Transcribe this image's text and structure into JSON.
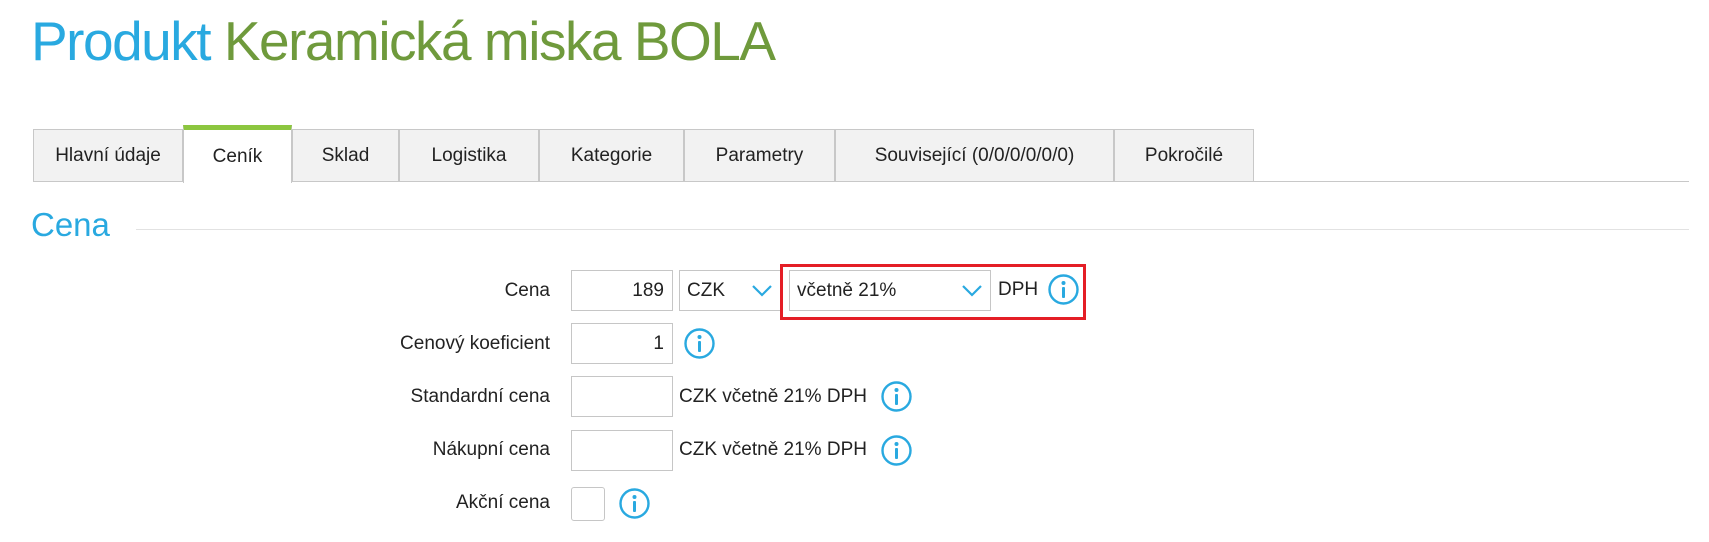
{
  "page_title": {
    "prefix": "Produkt",
    "name": "Keramická miska BOLA"
  },
  "tabs": [
    {
      "label": "Hlavní údaje",
      "active": false
    },
    {
      "label": "Ceník",
      "active": true
    },
    {
      "label": "Sklad",
      "active": false
    },
    {
      "label": "Logistika",
      "active": false
    },
    {
      "label": "Kategorie",
      "active": false
    },
    {
      "label": "Parametry",
      "active": false
    },
    {
      "label": "Související (0/0/0/0/0/0)",
      "active": false
    },
    {
      "label": "Pokročilé",
      "active": false
    }
  ],
  "section": {
    "title": "Cena"
  },
  "form": {
    "price": {
      "label": "Cena",
      "value": "189",
      "currency": "CZK",
      "vat_mode": "včetně 21%",
      "suffix": "DPH"
    },
    "coefficient": {
      "label": "Cenový koeficient",
      "value": "1"
    },
    "standard_price": {
      "label": "Standardní cena",
      "value": "",
      "suffix": "CZK včetně 21% DPH"
    },
    "purchase_price": {
      "label": "Nákupní cena",
      "value": "",
      "suffix": "CZK včetně 21% DPH"
    },
    "action_price": {
      "label": "Akční cena",
      "checked": false
    }
  },
  "colors": {
    "title_prefix": "#29a9e0",
    "title_name": "#6f9a3c",
    "active_tab_accent": "#8cc63f",
    "info_icon": "#29a9e0",
    "highlight_border": "#e41e26"
  },
  "icons": [
    "chevron-down-icon",
    "info-icon"
  ]
}
